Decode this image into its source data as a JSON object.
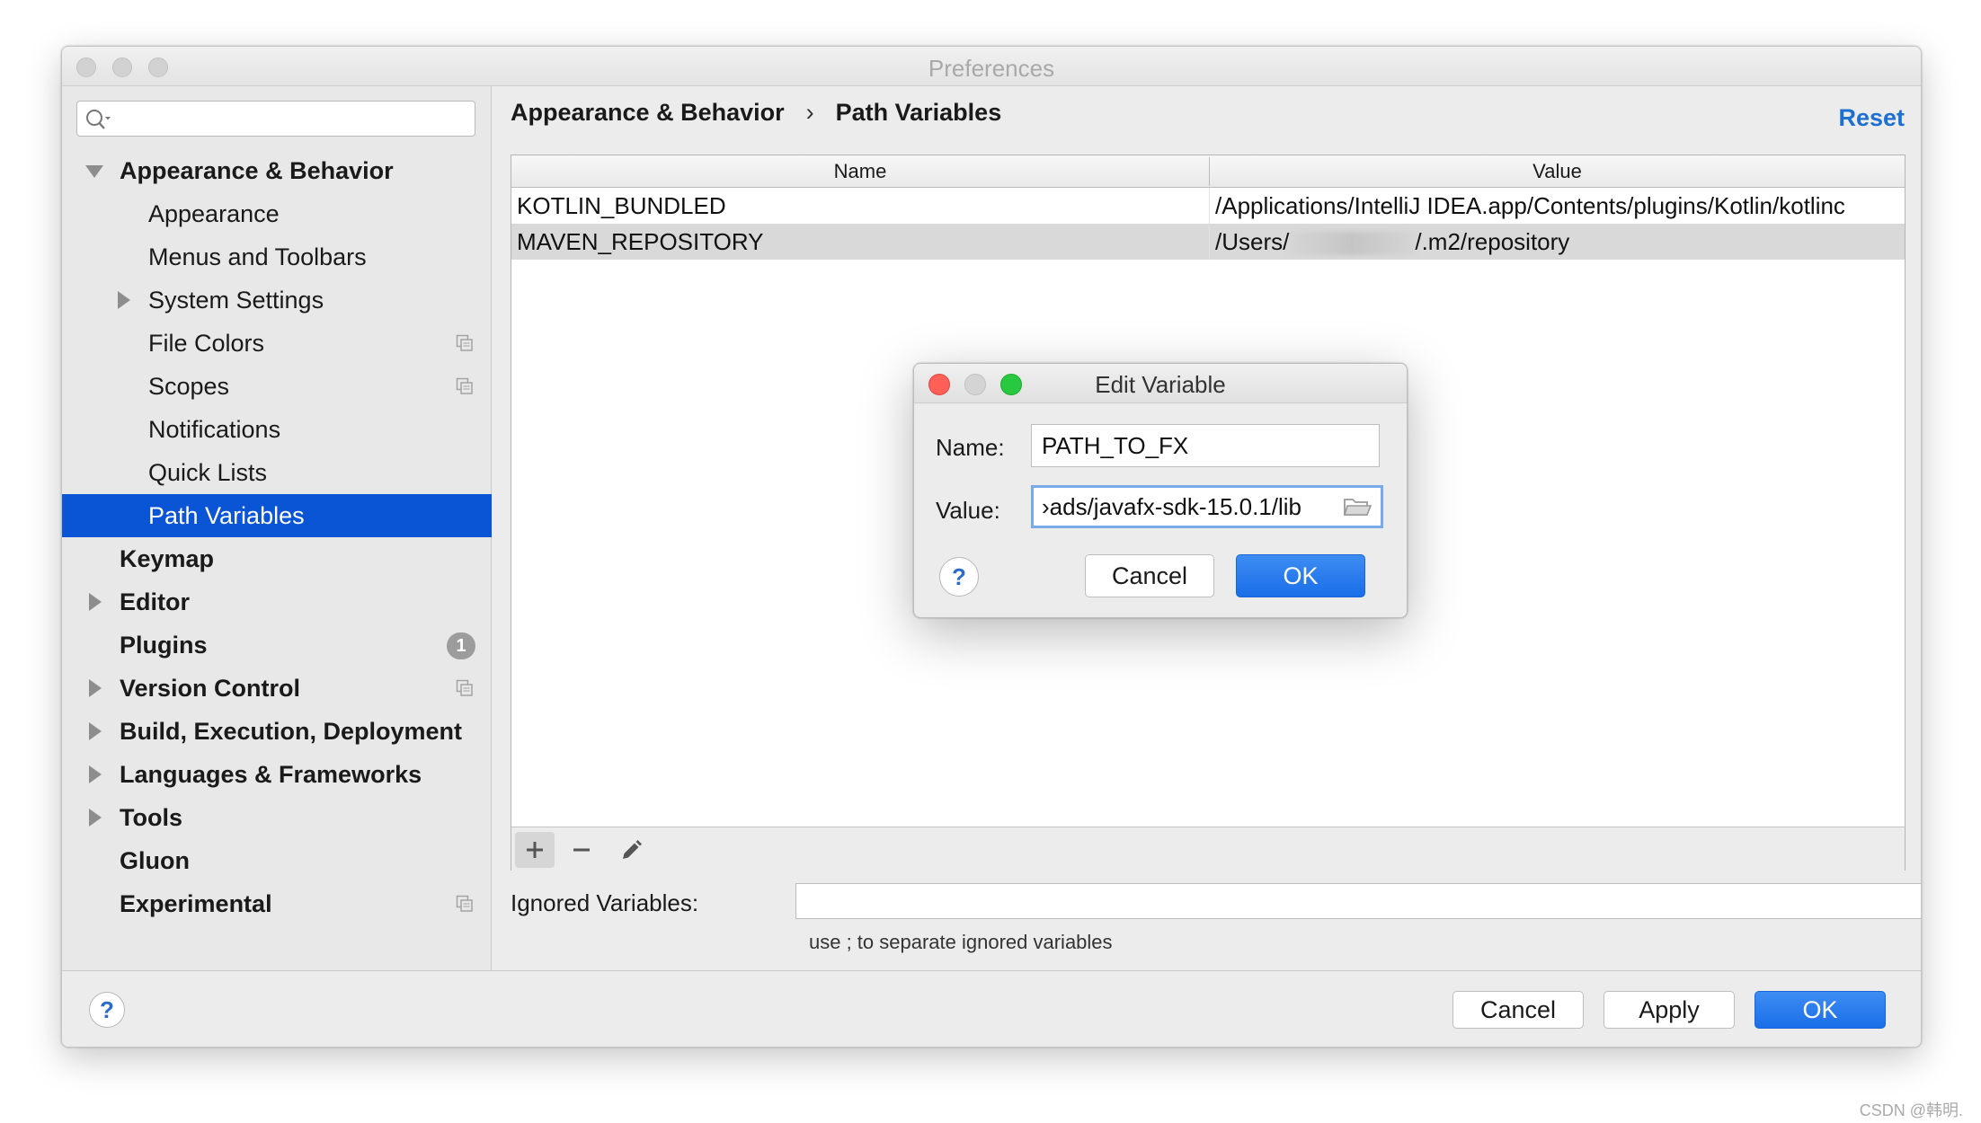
{
  "window": {
    "title": "Preferences"
  },
  "sidebar": {
    "search": {
      "placeholder": "",
      "value": ""
    },
    "items": [
      {
        "label": "Appearance & Behavior",
        "level": 0,
        "bold": true,
        "expanded": true
      },
      {
        "label": "Appearance",
        "level": 1
      },
      {
        "label": "Menus and Toolbars",
        "level": 1
      },
      {
        "label": "System Settings",
        "level": 1,
        "expandable": true
      },
      {
        "label": "File Colors",
        "level": 1,
        "copy_icon": true
      },
      {
        "label": "Scopes",
        "level": 1,
        "copy_icon": true
      },
      {
        "label": "Notifications",
        "level": 1
      },
      {
        "label": "Quick Lists",
        "level": 1
      },
      {
        "label": "Path Variables",
        "level": 1,
        "selected": true
      },
      {
        "label": "Keymap",
        "level": 0,
        "bold": true
      },
      {
        "label": "Editor",
        "level": 0,
        "bold": true,
        "expandable": true
      },
      {
        "label": "Plugins",
        "level": 0,
        "bold": true,
        "badge": "1"
      },
      {
        "label": "Version Control",
        "level": 0,
        "bold": true,
        "expandable": true,
        "copy_icon": true
      },
      {
        "label": "Build, Execution, Deployment",
        "level": 0,
        "bold": true,
        "expandable": true
      },
      {
        "label": "Languages & Frameworks",
        "level": 0,
        "bold": true,
        "expandable": true
      },
      {
        "label": "Tools",
        "level": 0,
        "bold": true,
        "expandable": true
      },
      {
        "label": "Gluon",
        "level": 0,
        "bold": true
      },
      {
        "label": "Experimental",
        "level": 0,
        "bold": true,
        "copy_icon": true
      }
    ]
  },
  "content": {
    "breadcrumb": {
      "parent": "Appearance & Behavior",
      "separator": "›",
      "current": "Path Variables"
    },
    "reset_label": "Reset",
    "table": {
      "columns": [
        "Name",
        "Value"
      ],
      "rows": [
        {
          "name": "KOTLIN_BUNDLED",
          "value": "/Applications/IntelliJ IDEA.app/Contents/plugins/Kotlin/kotlinc"
        },
        {
          "name": "MAVEN_REPOSITORY",
          "value_prefix": "/Users/",
          "value_suffix": "/.m2/repository",
          "selected": true
        }
      ]
    },
    "toolbar": {
      "add_icon": "plus-icon",
      "remove_icon": "minus-icon",
      "edit_icon": "pencil-icon"
    },
    "ignored_variables": {
      "label": "Ignored Variables:",
      "value": "",
      "hint": "use ; to separate ignored variables"
    }
  },
  "footer": {
    "help_label": "?",
    "cancel_label": "Cancel",
    "apply_label": "Apply",
    "ok_label": "OK"
  },
  "dialog": {
    "title": "Edit Variable",
    "name_label": "Name:",
    "name_value": "PATH_TO_FX",
    "value_label": "Value:",
    "value_value": "›ads/javafx-sdk-15.0.1/lib",
    "help_label": "?",
    "cancel_label": "Cancel",
    "ok_label": "OK"
  },
  "watermark": "CSDN @韩明.",
  "colors": {
    "selection": "#0a54d6",
    "link": "#1d6fd1",
    "primary_button": "#1a6ee8",
    "traffic_red": "#fe5f57",
    "traffic_green": "#28c840"
  }
}
